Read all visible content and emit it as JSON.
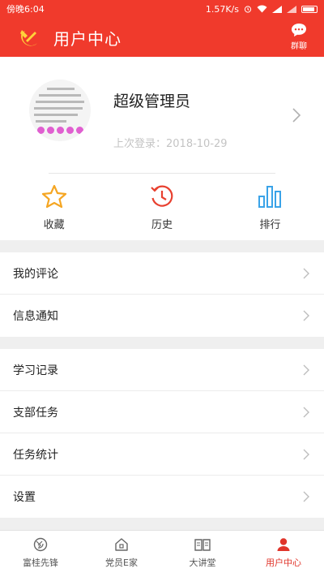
{
  "status_bar": {
    "time": "傍晚6:04",
    "network_speed": "1.57K/s"
  },
  "header": {
    "title": "用户中心",
    "group_label": "群聊"
  },
  "profile": {
    "username": "超级管理员",
    "last_login": "上次登录：2018-10-29"
  },
  "quick_actions": [
    {
      "label": "收藏",
      "icon": "star-icon"
    },
    {
      "label": "历史",
      "icon": "history-icon"
    },
    {
      "label": "排行",
      "icon": "bar-chart-icon"
    }
  ],
  "menu_group_1": [
    {
      "label": "我的评论"
    },
    {
      "label": "信息通知"
    }
  ],
  "menu_group_2": [
    {
      "label": "学习记录"
    },
    {
      "label": "支部任务"
    },
    {
      "label": "任务统计"
    },
    {
      "label": "设置"
    }
  ],
  "tabs": [
    {
      "label": "富桂先锋",
      "icon": "pioneer-icon"
    },
    {
      "label": "党员E家",
      "icon": "home-icon"
    },
    {
      "label": "大讲堂",
      "icon": "book-icon"
    },
    {
      "label": "用户中心",
      "icon": "user-icon",
      "active": true
    }
  ],
  "colors": {
    "brand_red": "#f03a2c",
    "action_orange": "#f5a623",
    "action_red": "#e8402f",
    "action_blue": "#3aa3e8"
  }
}
